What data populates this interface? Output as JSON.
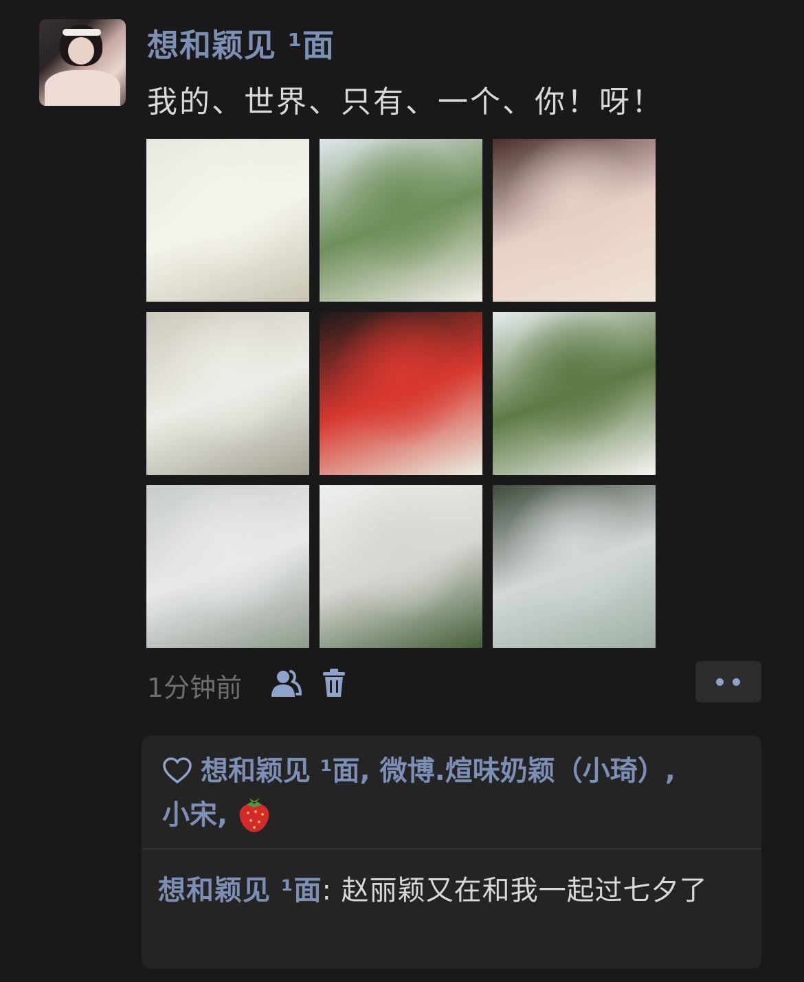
{
  "post": {
    "author": "想和颖见 ¹面",
    "text": "我的、世界、只有、一个、你！呀！",
    "images": [
      {
        "name": "bride-veil-photo",
        "colors": [
          "#e9e8df",
          "#f5f4ec",
          "#c9c4b2"
        ]
      },
      {
        "name": "wedding-arch-seaside-photo",
        "colors": [
          "#dfe6ec",
          "#6f8f5a",
          "#f2eee8"
        ]
      },
      {
        "name": "bride-selfie-photo",
        "colors": [
          "#4a2f2c",
          "#e8cfc6",
          "#efe3d3"
        ]
      },
      {
        "name": "bouquet-on-table-photo",
        "colors": [
          "#cfc9bd",
          "#ecece6",
          "#a5a295"
        ]
      },
      {
        "name": "red-xi-and-flowers-photo",
        "colors": [
          "#1b1b1b",
          "#d8382f",
          "#e9efe3"
        ]
      },
      {
        "name": "garden-wedding-arch-photo",
        "colors": [
          "#e7ecee",
          "#5d7a45",
          "#f6f5f3"
        ]
      },
      {
        "name": "shoes-and-veil-photo",
        "colors": [
          "#c8cbcc",
          "#e7e9ea",
          "#8f9a8c"
        ]
      },
      {
        "name": "white-draped-table-photo",
        "colors": [
          "#eeeeec",
          "#d6d6d2",
          "#45603a"
        ]
      },
      {
        "name": "hands-under-veil-photo",
        "colors": [
          "#3f4a3c",
          "#d2d8d6",
          "#9fb0a4"
        ]
      }
    ],
    "time": "1分钟前"
  },
  "likes": {
    "names_line1": "想和颖见 ¹面, 微博.煊味奶颖（小琦）,",
    "names_line2": "小宋,"
  },
  "comment": {
    "author": "想和颖见 ¹面",
    "separator": ": ",
    "text": "赵丽颖又在和我一起过七夕了"
  },
  "colors": {
    "background": "#191919",
    "name_blue": "#7d8fb4",
    "text": "#d9d9d9"
  }
}
